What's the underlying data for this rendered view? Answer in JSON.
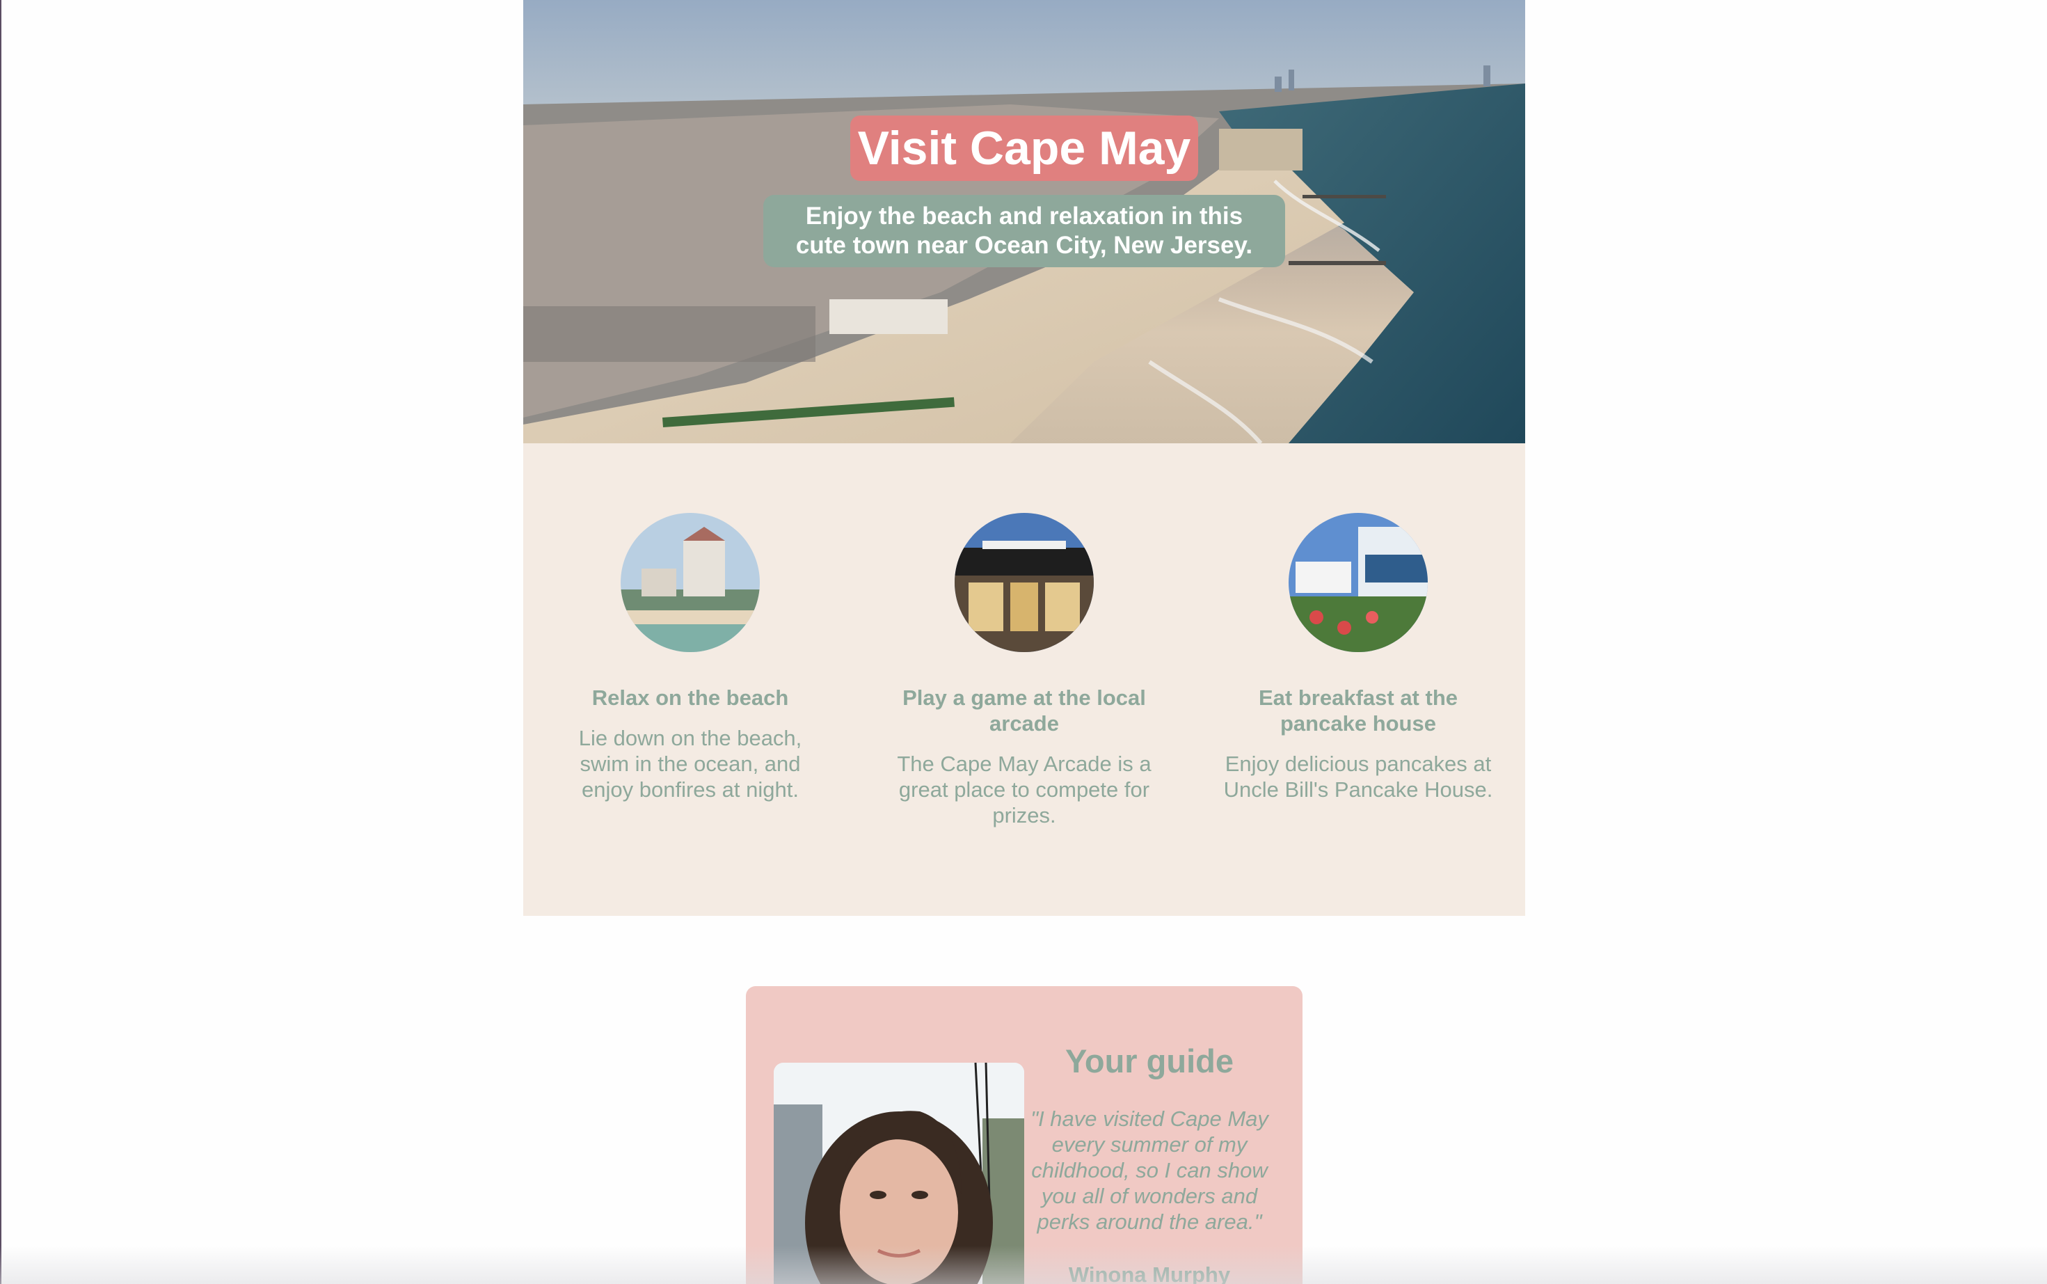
{
  "hero": {
    "title": "Visit Cape May",
    "subtitle_line1": "Enjoy the beach and relaxation in this",
    "subtitle_line2": "cute town near Ocean City, New Jersey.",
    "image": "aerial-beach-town-photo"
  },
  "features": [
    {
      "image": "beach-hotel-photo",
      "title": "Relax on the beach",
      "text_lines": [
        "Lie down on the beach,",
        "swim in the ocean, and",
        "enjoy bonfires at night."
      ]
    },
    {
      "image": "arcade-storefront-photo",
      "title_lines": [
        "Play a game at the local",
        "arcade"
      ],
      "text_lines": [
        "The Cape May Arcade is a",
        "great place to compete for",
        "prizes."
      ]
    },
    {
      "image": "pancake-house-photo",
      "title_lines": [
        "Eat breakfast at the",
        "pancake house"
      ],
      "text_lines": [
        "Enjoy delicious pancakes at",
        "Uncle Bill's Pancake House."
      ]
    }
  ],
  "guide": {
    "heading": "Your guide",
    "quote_lines": [
      "\"I have visited Cape May",
      "every summer of my",
      "childhood, so I can show",
      "you all of wonders and",
      "perks around the area.\""
    ],
    "name": "Winona Murphy",
    "image": "guide-portrait-photo"
  },
  "colors": {
    "accent_pink": "#e0807f",
    "accent_green": "#8ea89b",
    "section_bg": "#f4ebe3",
    "guide_bg": "#f0c9c4"
  }
}
